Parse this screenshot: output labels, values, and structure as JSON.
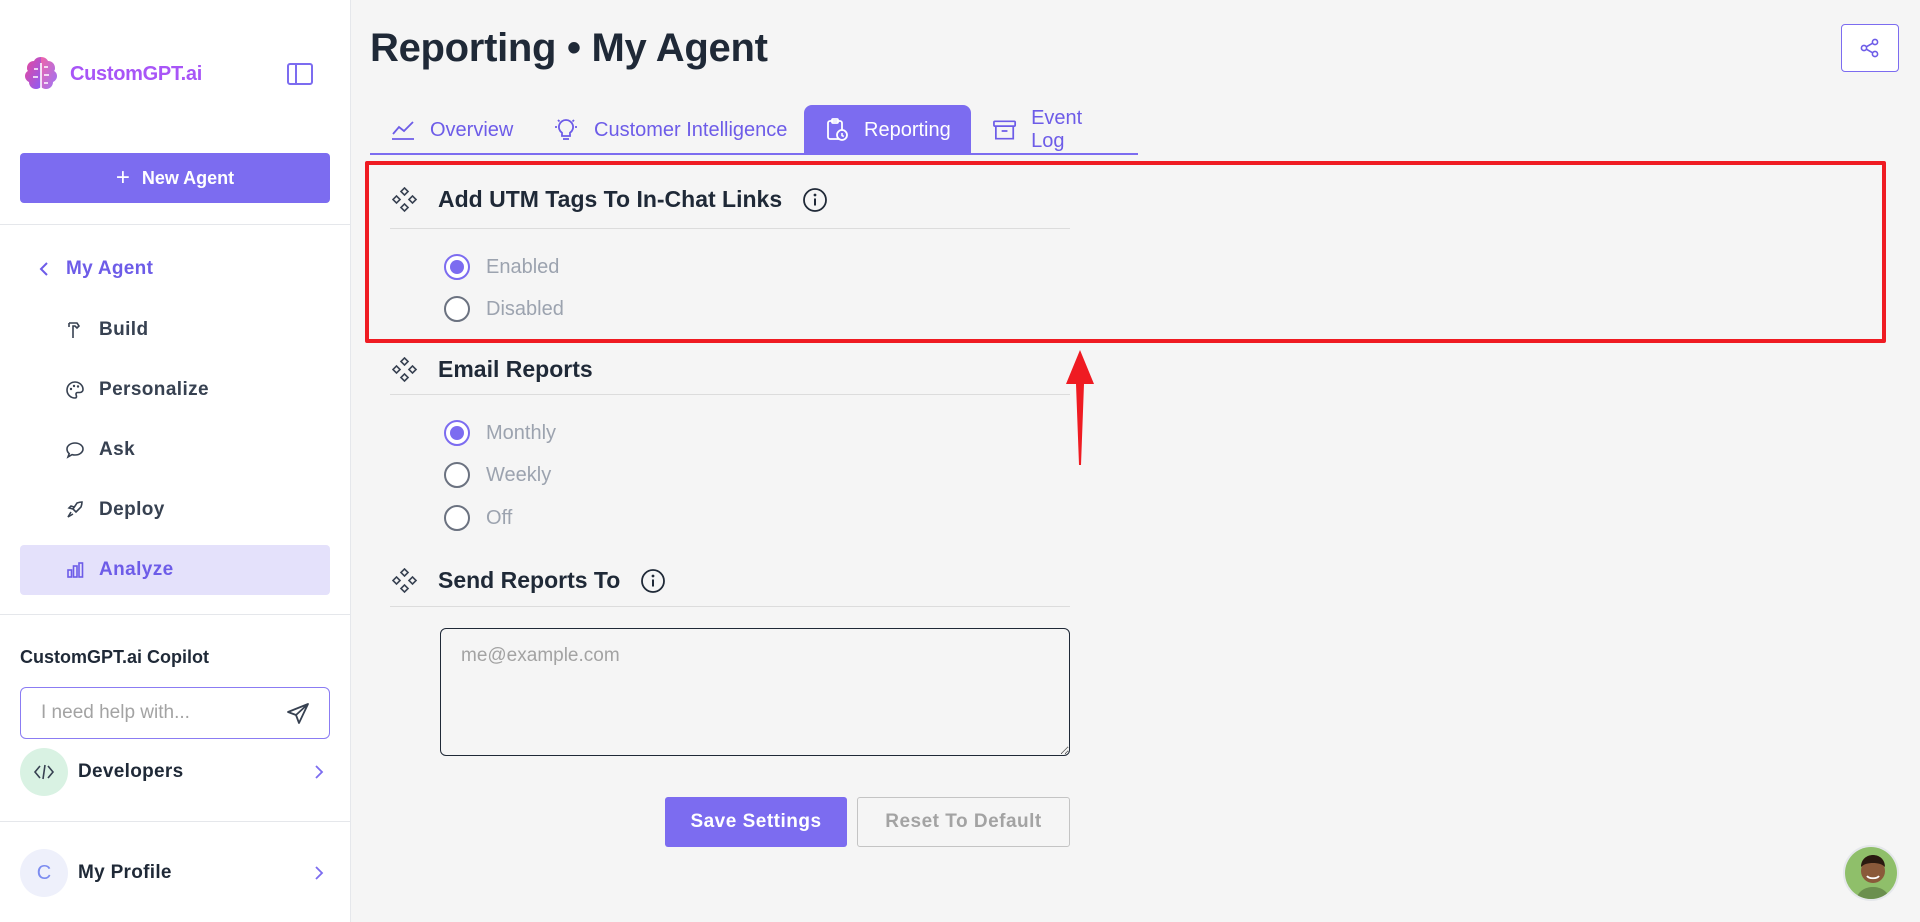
{
  "brand": {
    "name": "CustomGPT.ai"
  },
  "sidebar": {
    "new_agent_label": "New Agent",
    "back_label": "My Agent",
    "items": [
      {
        "label": "Build",
        "icon": "hammer-icon"
      },
      {
        "label": "Personalize",
        "icon": "palette-icon"
      },
      {
        "label": "Ask",
        "icon": "chat-icon"
      },
      {
        "label": "Deploy",
        "icon": "rocket-icon"
      },
      {
        "label": "Analyze",
        "icon": "bar-chart-icon",
        "active": true
      }
    ],
    "copilot": {
      "title": "CustomGPT.ai Copilot",
      "placeholder": "I need help with..."
    },
    "developers": {
      "label": "Developers"
    },
    "profile": {
      "label": "My Profile",
      "initial": "C"
    }
  },
  "main": {
    "title": "Reporting • My Agent",
    "tabs": [
      {
        "label": "Overview",
        "icon": "trend-line-icon"
      },
      {
        "label": "Customer Intelligence",
        "icon": "lightbulb-gear-icon"
      },
      {
        "label": "Reporting",
        "icon": "clipboard-clock-icon",
        "active": true
      },
      {
        "label": "Event Log",
        "icon": "archive-icon"
      }
    ],
    "utm": {
      "title": "Add UTM Tags To In-Chat Links",
      "options": [
        {
          "label": "Enabled",
          "selected": true
        },
        {
          "label": "Disabled",
          "selected": false
        }
      ]
    },
    "email_reports": {
      "title": "Email Reports",
      "options": [
        {
          "label": "Monthly",
          "selected": true
        },
        {
          "label": "Weekly",
          "selected": false
        },
        {
          "label": "Off",
          "selected": false
        }
      ]
    },
    "send_reports": {
      "title": "Send Reports To",
      "placeholder": "me@example.com"
    },
    "save_label": "Save Settings",
    "reset_label": "Reset To Default"
  },
  "colors": {
    "accent": "#7c6cf0",
    "highlight": "#ef1b22"
  }
}
